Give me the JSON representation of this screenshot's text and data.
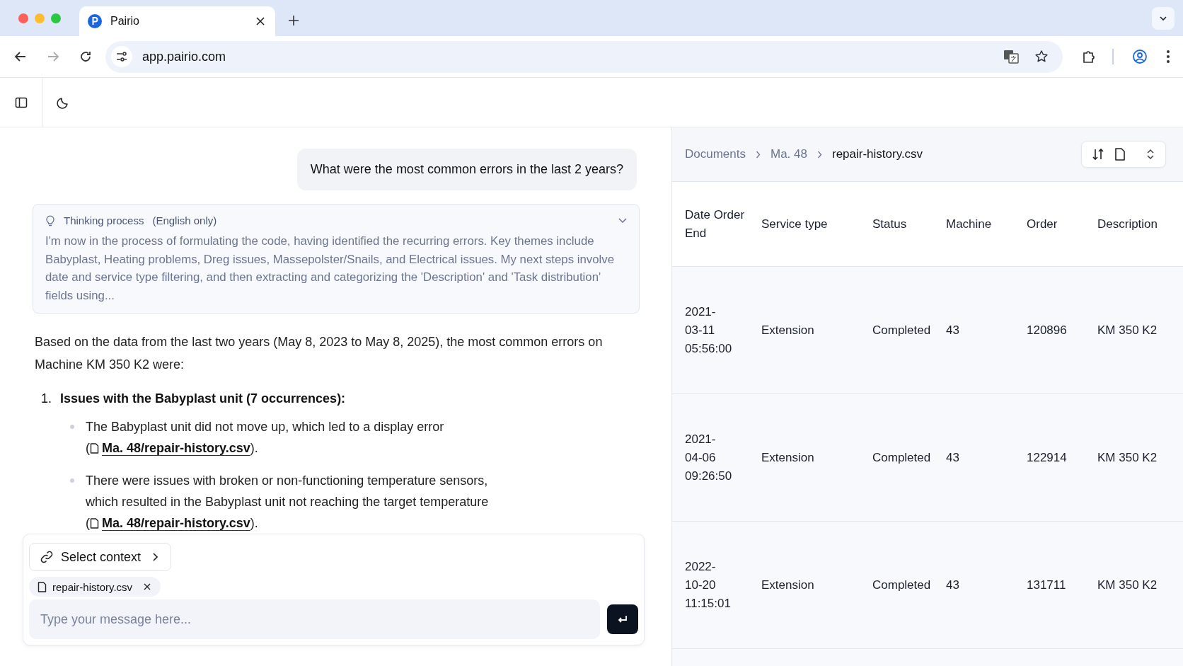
{
  "browser": {
    "tabs": [
      {
        "title": "Pairio",
        "selected": true
      }
    ],
    "address": "app.pairio.com"
  },
  "chat": {
    "user_message": "What were the most common errors in the last 2 years?",
    "thinking": {
      "title": "Thinking process",
      "note": "(English only)",
      "text": "I'm now in the process of formulating the code, having identified the recurring errors. Key themes include Babyplast, Heating problems, Dreg issues, Massepolster/Snails, and Electrical issues. My next steps involve date and service type filtering, and then extracting and categorizing the 'Description' and 'Task distribution' fields using..."
    },
    "answer": {
      "intro": "Based on the data from the last two years (May 8, 2023 to May 8, 2025), the most common errors on Machine KM 350 K2 were:",
      "items": [
        {
          "number": "1.",
          "heading": "Issues with the Babyplast unit (7 occurrences):",
          "bullets": [
            {
              "text": "The Babyplast unit did not move up, which led to a display error",
              "source_open": "(",
              "source": "Ma. 48/repair-history.csv",
              "source_close": ")."
            },
            {
              "text": "There were issues with broken or non-functioning temperature sensors, which resulted in the Babyplast unit not reaching the target temperature",
              "source_open": "(",
              "source": "Ma. 48/repair-history.csv",
              "source_close": ")."
            }
          ]
        }
      ]
    }
  },
  "composer": {
    "context_button": "Select context",
    "attachments": [
      {
        "name": "repair-history.csv"
      }
    ],
    "placeholder": "Type your message here..."
  },
  "panel": {
    "breadcrumb": [
      "Documents",
      "Ma. 48",
      "repair-history.csv"
    ],
    "table": {
      "columns": [
        "Date Order End",
        "Service type",
        "Status",
        "Machine",
        "Order",
        "Description"
      ],
      "rows": [
        [
          "2021-03-11 05:56:00",
          "Extension",
          "Completed",
          "43",
          "120896",
          "KM 350 K2"
        ],
        [
          "2021-04-06 09:26:50",
          "Extension",
          "Completed",
          "43",
          "122914",
          "KM 350 K2"
        ],
        [
          "2022-10-20 11:15:01",
          "Extension",
          "Completed",
          "43",
          "131711",
          "KM 350 K2"
        ]
      ]
    }
  }
}
